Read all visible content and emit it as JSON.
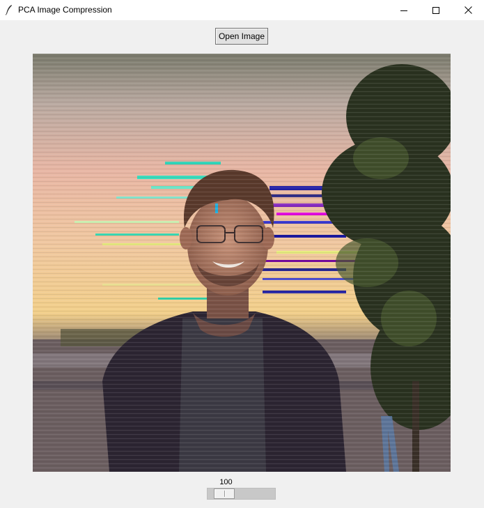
{
  "window": {
    "title": "PCA Image Compression",
    "icon": "feather-icon",
    "controls": [
      "minimize-icon",
      "maximize-icon",
      "close-icon"
    ]
  },
  "toolbar": {
    "open_label": "Open Image"
  },
  "image": {
    "description_icon": "compressed-portrait-image"
  },
  "slider": {
    "value_label": "100",
    "value": 100,
    "fraction": 0.14
  },
  "colors": {
    "window_bg": "#f0f0f0",
    "titlebar_bg": "#ffffff",
    "button_bg": "#e1e1e1",
    "trough": "#c8c8c8"
  }
}
